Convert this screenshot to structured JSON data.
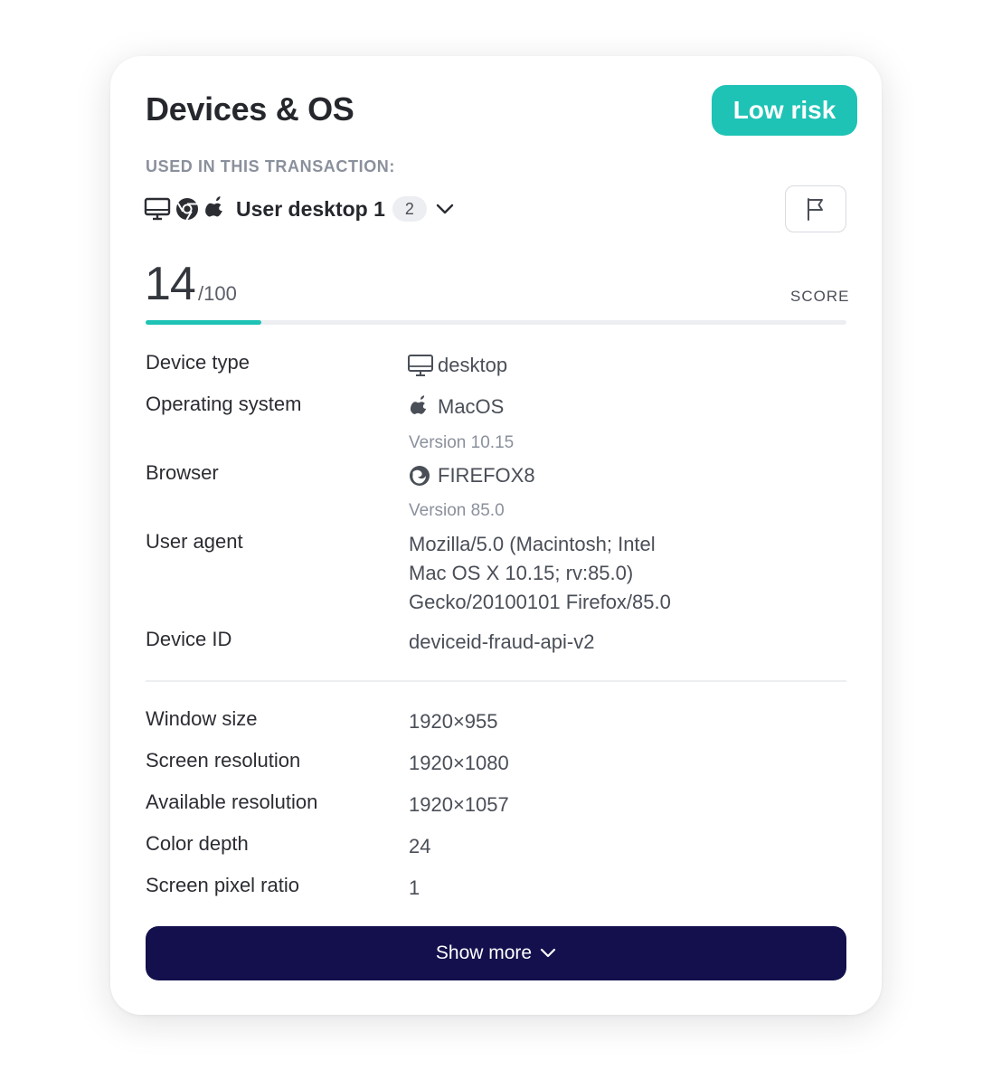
{
  "card": {
    "title": "Devices & OS",
    "risk_badge": "Low risk",
    "section_label": "USED IN THIS TRANSACTION:",
    "device": {
      "icons": [
        "desktop-icon",
        "chrome-icon",
        "apple-icon"
      ],
      "name": "User desktop 1",
      "count": "2"
    },
    "score": {
      "value": "14",
      "max": "/100",
      "label": "SCORE",
      "fraction": 0.165
    },
    "details": [
      {
        "key": "Device type",
        "value": "desktop",
        "icon": "desktop-icon"
      },
      {
        "key": "Operating system",
        "value": "MacOS",
        "sub": "Version 10.15",
        "icon": "apple-icon"
      },
      {
        "key": "Browser",
        "value": "FIREFOX8",
        "sub": "Version 85.0",
        "icon": "firefox-icon"
      },
      {
        "key": "User agent",
        "value_lines": [
          "Mozilla/5.0 (Macintosh; Intel",
          "Mac OS X 10.15; rv:85.0)",
          "Gecko/20100101 Firefox/85.0"
        ]
      },
      {
        "key": "Device ID",
        "value": "deviceid-fraud-api-v2"
      }
    ],
    "screen": [
      {
        "key": "Window size",
        "value": "1920×955"
      },
      {
        "key": "Screen resolution",
        "value": "1920×1080"
      },
      {
        "key": "Available resolution",
        "value": "1920×1057"
      },
      {
        "key": "Color depth",
        "value": "24"
      },
      {
        "key": "Screen pixel ratio",
        "value": "1"
      }
    ],
    "show_more": "Show more"
  },
  "colors": {
    "accent": "#1ec3b5",
    "button": "#13104d",
    "muted": "#8a909c"
  }
}
